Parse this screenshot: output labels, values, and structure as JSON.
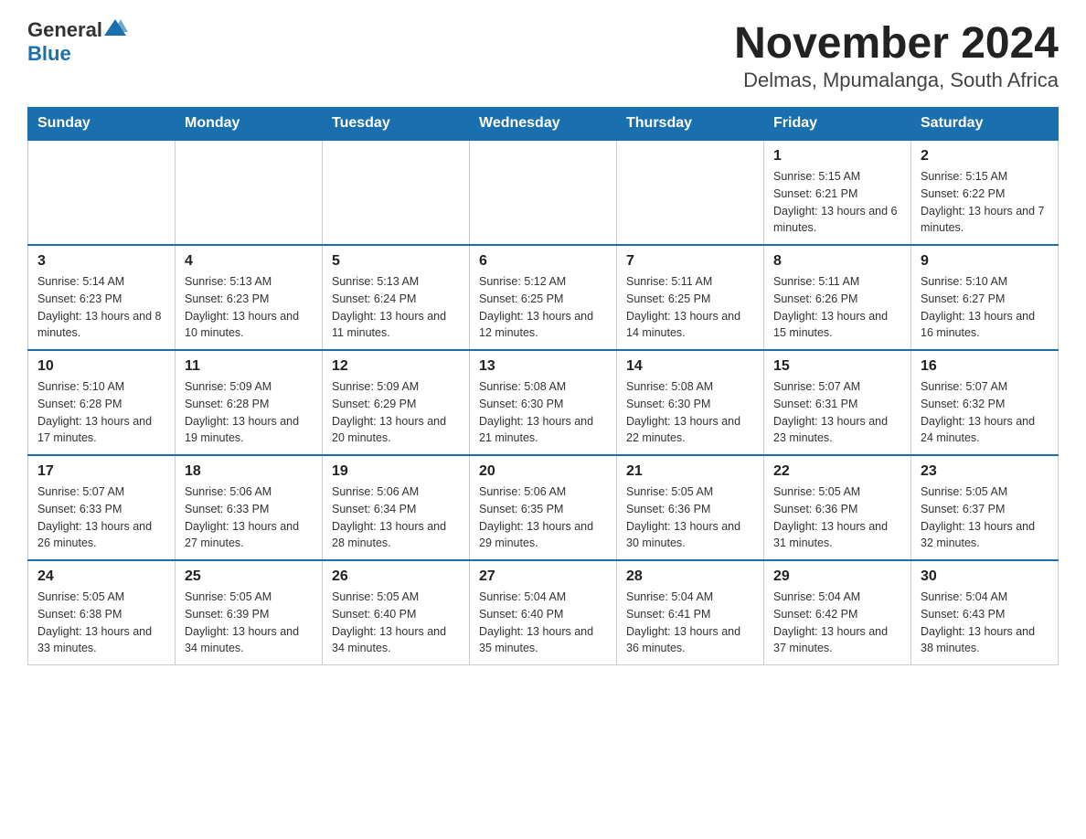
{
  "header": {
    "logo_general": "General",
    "logo_blue": "Blue",
    "title": "November 2024",
    "subtitle": "Delmas, Mpumalanga, South Africa"
  },
  "days_of_week": [
    "Sunday",
    "Monday",
    "Tuesday",
    "Wednesday",
    "Thursday",
    "Friday",
    "Saturday"
  ],
  "weeks": [
    [
      {
        "day": "",
        "sunrise": "",
        "sunset": "",
        "daylight": ""
      },
      {
        "day": "",
        "sunrise": "",
        "sunset": "",
        "daylight": ""
      },
      {
        "day": "",
        "sunrise": "",
        "sunset": "",
        "daylight": ""
      },
      {
        "day": "",
        "sunrise": "",
        "sunset": "",
        "daylight": ""
      },
      {
        "day": "",
        "sunrise": "",
        "sunset": "",
        "daylight": ""
      },
      {
        "day": "1",
        "sunrise": "Sunrise: 5:15 AM",
        "sunset": "Sunset: 6:21 PM",
        "daylight": "Daylight: 13 hours and 6 minutes."
      },
      {
        "day": "2",
        "sunrise": "Sunrise: 5:15 AM",
        "sunset": "Sunset: 6:22 PM",
        "daylight": "Daylight: 13 hours and 7 minutes."
      }
    ],
    [
      {
        "day": "3",
        "sunrise": "Sunrise: 5:14 AM",
        "sunset": "Sunset: 6:23 PM",
        "daylight": "Daylight: 13 hours and 8 minutes."
      },
      {
        "day": "4",
        "sunrise": "Sunrise: 5:13 AM",
        "sunset": "Sunset: 6:23 PM",
        "daylight": "Daylight: 13 hours and 10 minutes."
      },
      {
        "day": "5",
        "sunrise": "Sunrise: 5:13 AM",
        "sunset": "Sunset: 6:24 PM",
        "daylight": "Daylight: 13 hours and 11 minutes."
      },
      {
        "day": "6",
        "sunrise": "Sunrise: 5:12 AM",
        "sunset": "Sunset: 6:25 PM",
        "daylight": "Daylight: 13 hours and 12 minutes."
      },
      {
        "day": "7",
        "sunrise": "Sunrise: 5:11 AM",
        "sunset": "Sunset: 6:25 PM",
        "daylight": "Daylight: 13 hours and 14 minutes."
      },
      {
        "day": "8",
        "sunrise": "Sunrise: 5:11 AM",
        "sunset": "Sunset: 6:26 PM",
        "daylight": "Daylight: 13 hours and 15 minutes."
      },
      {
        "day": "9",
        "sunrise": "Sunrise: 5:10 AM",
        "sunset": "Sunset: 6:27 PM",
        "daylight": "Daylight: 13 hours and 16 minutes."
      }
    ],
    [
      {
        "day": "10",
        "sunrise": "Sunrise: 5:10 AM",
        "sunset": "Sunset: 6:28 PM",
        "daylight": "Daylight: 13 hours and 17 minutes."
      },
      {
        "day": "11",
        "sunrise": "Sunrise: 5:09 AM",
        "sunset": "Sunset: 6:28 PM",
        "daylight": "Daylight: 13 hours and 19 minutes."
      },
      {
        "day": "12",
        "sunrise": "Sunrise: 5:09 AM",
        "sunset": "Sunset: 6:29 PM",
        "daylight": "Daylight: 13 hours and 20 minutes."
      },
      {
        "day": "13",
        "sunrise": "Sunrise: 5:08 AM",
        "sunset": "Sunset: 6:30 PM",
        "daylight": "Daylight: 13 hours and 21 minutes."
      },
      {
        "day": "14",
        "sunrise": "Sunrise: 5:08 AM",
        "sunset": "Sunset: 6:30 PM",
        "daylight": "Daylight: 13 hours and 22 minutes."
      },
      {
        "day": "15",
        "sunrise": "Sunrise: 5:07 AM",
        "sunset": "Sunset: 6:31 PM",
        "daylight": "Daylight: 13 hours and 23 minutes."
      },
      {
        "day": "16",
        "sunrise": "Sunrise: 5:07 AM",
        "sunset": "Sunset: 6:32 PM",
        "daylight": "Daylight: 13 hours and 24 minutes."
      }
    ],
    [
      {
        "day": "17",
        "sunrise": "Sunrise: 5:07 AM",
        "sunset": "Sunset: 6:33 PM",
        "daylight": "Daylight: 13 hours and 26 minutes."
      },
      {
        "day": "18",
        "sunrise": "Sunrise: 5:06 AM",
        "sunset": "Sunset: 6:33 PM",
        "daylight": "Daylight: 13 hours and 27 minutes."
      },
      {
        "day": "19",
        "sunrise": "Sunrise: 5:06 AM",
        "sunset": "Sunset: 6:34 PM",
        "daylight": "Daylight: 13 hours and 28 minutes."
      },
      {
        "day": "20",
        "sunrise": "Sunrise: 5:06 AM",
        "sunset": "Sunset: 6:35 PM",
        "daylight": "Daylight: 13 hours and 29 minutes."
      },
      {
        "day": "21",
        "sunrise": "Sunrise: 5:05 AM",
        "sunset": "Sunset: 6:36 PM",
        "daylight": "Daylight: 13 hours and 30 minutes."
      },
      {
        "day": "22",
        "sunrise": "Sunrise: 5:05 AM",
        "sunset": "Sunset: 6:36 PM",
        "daylight": "Daylight: 13 hours and 31 minutes."
      },
      {
        "day": "23",
        "sunrise": "Sunrise: 5:05 AM",
        "sunset": "Sunset: 6:37 PM",
        "daylight": "Daylight: 13 hours and 32 minutes."
      }
    ],
    [
      {
        "day": "24",
        "sunrise": "Sunrise: 5:05 AM",
        "sunset": "Sunset: 6:38 PM",
        "daylight": "Daylight: 13 hours and 33 minutes."
      },
      {
        "day": "25",
        "sunrise": "Sunrise: 5:05 AM",
        "sunset": "Sunset: 6:39 PM",
        "daylight": "Daylight: 13 hours and 34 minutes."
      },
      {
        "day": "26",
        "sunrise": "Sunrise: 5:05 AM",
        "sunset": "Sunset: 6:40 PM",
        "daylight": "Daylight: 13 hours and 34 minutes."
      },
      {
        "day": "27",
        "sunrise": "Sunrise: 5:04 AM",
        "sunset": "Sunset: 6:40 PM",
        "daylight": "Daylight: 13 hours and 35 minutes."
      },
      {
        "day": "28",
        "sunrise": "Sunrise: 5:04 AM",
        "sunset": "Sunset: 6:41 PM",
        "daylight": "Daylight: 13 hours and 36 minutes."
      },
      {
        "day": "29",
        "sunrise": "Sunrise: 5:04 AM",
        "sunset": "Sunset: 6:42 PM",
        "daylight": "Daylight: 13 hours and 37 minutes."
      },
      {
        "day": "30",
        "sunrise": "Sunrise: 5:04 AM",
        "sunset": "Sunset: 6:43 PM",
        "daylight": "Daylight: 13 hours and 38 minutes."
      }
    ]
  ]
}
